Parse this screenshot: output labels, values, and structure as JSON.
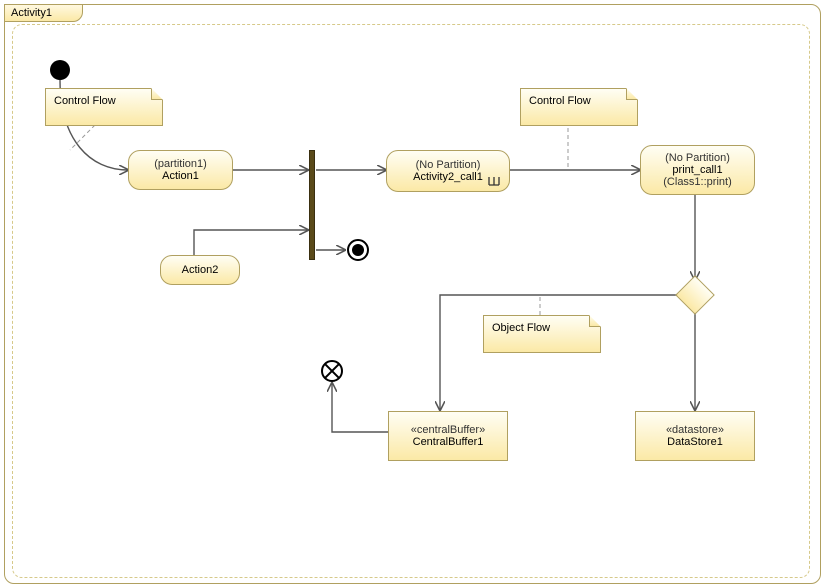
{
  "frame": {
    "title": "Activity1"
  },
  "notes": {
    "cf1": "Control Flow",
    "cf2": "Control Flow",
    "of1": "Object Flow"
  },
  "actions": {
    "action1": {
      "partition": "(partition1)",
      "name": "Action1"
    },
    "action2": {
      "name": "Action2"
    },
    "activity2call": {
      "partition": "(No Partition)",
      "name": "Activity2_call1"
    },
    "printcall": {
      "partition": "(No Partition)",
      "name": "print_call1",
      "sub": "(Class1::print)"
    }
  },
  "objects": {
    "centralbuffer": {
      "stereo": "«centralBuffer»",
      "name": "CentralBuffer1"
    },
    "datastore": {
      "stereo": "«datastore»",
      "name": "DataStore1"
    }
  },
  "chart_data": {
    "type": "activity-diagram",
    "title": "Activity1",
    "nodes": [
      {
        "id": "initial",
        "kind": "initial"
      },
      {
        "id": "action1",
        "kind": "action",
        "label": "Action1",
        "partition": "partition1"
      },
      {
        "id": "action2",
        "kind": "action",
        "label": "Action2"
      },
      {
        "id": "fork1",
        "kind": "fork"
      },
      {
        "id": "activity2_call1",
        "kind": "callBehavior",
        "label": "Activity2_call1",
        "partition": "No Partition"
      },
      {
        "id": "activityFinal",
        "kind": "activityFinal"
      },
      {
        "id": "print_call1",
        "kind": "callOperation",
        "label": "print_call1",
        "operation": "Class1::print",
        "partition": "No Partition"
      },
      {
        "id": "decision1",
        "kind": "decision"
      },
      {
        "id": "flowFinal",
        "kind": "flowFinal"
      },
      {
        "id": "centralBuffer1",
        "kind": "centralBuffer",
        "label": "CentralBuffer1"
      },
      {
        "id": "dataStore1",
        "kind": "datastore",
        "label": "DataStore1"
      }
    ],
    "edges": [
      {
        "from": "initial",
        "to": "action1",
        "kind": "controlFlow",
        "noteRef": "cf1"
      },
      {
        "from": "action1",
        "to": "fork1",
        "kind": "controlFlow"
      },
      {
        "from": "action2",
        "to": "fork1",
        "kind": "controlFlow"
      },
      {
        "from": "fork1",
        "to": "activity2_call1",
        "kind": "controlFlow"
      },
      {
        "from": "fork1",
        "to": "activityFinal",
        "kind": "controlFlow"
      },
      {
        "from": "activity2_call1",
        "to": "print_call1",
        "kind": "controlFlow",
        "noteRef": "cf2"
      },
      {
        "from": "print_call1",
        "to": "decision1",
        "kind": "controlFlow"
      },
      {
        "from": "decision1",
        "to": "centralBuffer1",
        "kind": "objectFlow",
        "noteRef": "of1"
      },
      {
        "from": "decision1",
        "to": "dataStore1",
        "kind": "objectFlow"
      },
      {
        "from": "centralBuffer1",
        "to": "flowFinal",
        "kind": "objectFlow"
      }
    ],
    "notes": [
      {
        "id": "cf1",
        "text": "Control Flow"
      },
      {
        "id": "cf2",
        "text": "Control Flow"
      },
      {
        "id": "of1",
        "text": "Object Flow"
      }
    ]
  }
}
